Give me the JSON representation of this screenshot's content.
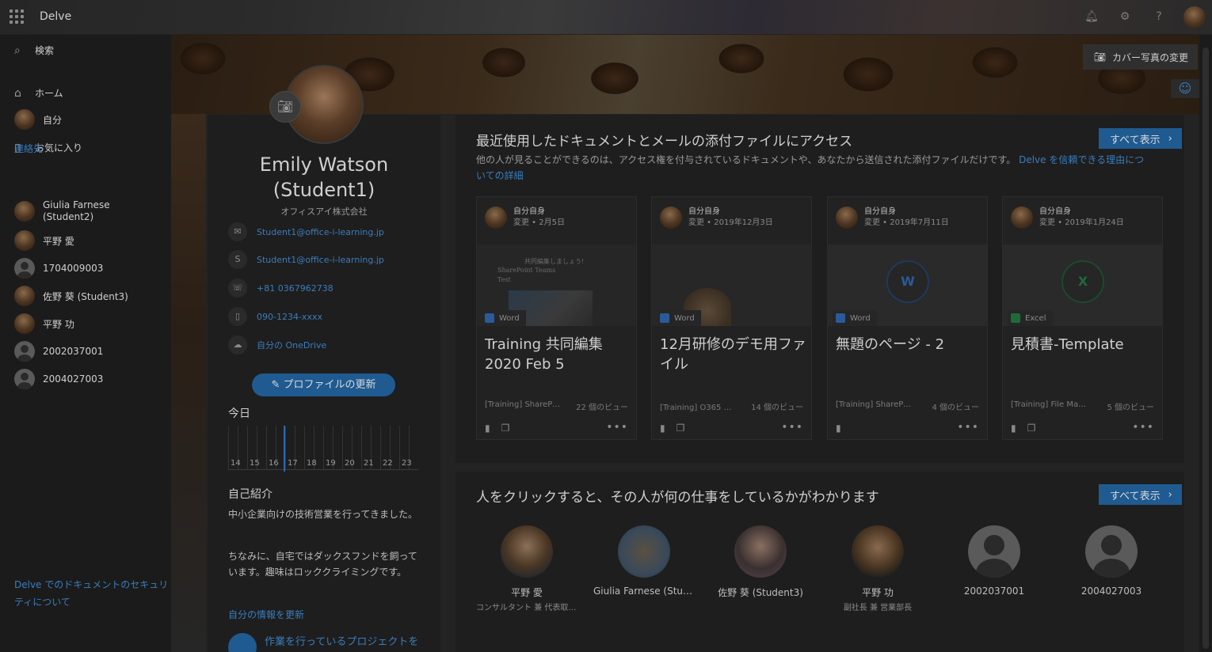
{
  "topbar": {
    "app_title": "Delve"
  },
  "leftnav": {
    "search_label": "検索",
    "items": [
      {
        "label": "ホーム"
      },
      {
        "label": "自分"
      },
      {
        "label": "お気に入り"
      }
    ],
    "contacts_heading": "連絡先",
    "contacts": [
      {
        "name": "Giulia Farnese (Student2)"
      },
      {
        "name": "平野 愛"
      },
      {
        "name": "1704009003"
      },
      {
        "name": "佐野 葵 (Student3)"
      },
      {
        "name": "平野 功"
      },
      {
        "name": "2002037001"
      },
      {
        "name": "2004027003"
      }
    ],
    "security_link": "Delve でのドキュメントのセキュリティについて"
  },
  "cover": {
    "change_label": "カバー写真の変更"
  },
  "profile": {
    "name": "Emily Watson (Student1)",
    "company": "オフィスアイ株式会社",
    "email": "Student1@office-i-learning.jp",
    "im": "Student1@office-i-learning.jp",
    "phone": "+81 0367962738",
    "mobile": "090-1234-xxxx",
    "onedrive": "自分の OneDrive",
    "update_button": "プロファイルの更新",
    "today_label": "今日",
    "hours": [
      "14",
      "15",
      "16",
      "17",
      "18",
      "19",
      "20",
      "21",
      "22",
      "23"
    ],
    "about_heading": "自己紹介",
    "about_p1": "中小企業向けの技術営業を行ってきました。",
    "about_p2": "ちなみに、自宅ではダックスフンドを飼っています。趣味はロッククライミングです。",
    "update_info": "自分の情報を更新",
    "projects_text": "作業を行っているプロジェクトを"
  },
  "docs": {
    "title": "最近使用したドキュメントとメールの添付ファイルにアクセス",
    "desc": "他の人が見ることができるのは、アクセス権を付与されているドキュメントや、あなたから送信された添付ファイルだけです。",
    "desc_link": "Delve を信頼できる理由についての詳細",
    "see_all": "すべて表示",
    "cards": [
      {
        "owner": "自分自身",
        "modified": "変更 • 2月5日",
        "type": "Word",
        "title": "Training 共同編集 2020 Feb 5",
        "location": "[Training] SharePoint",
        "views": "22 個のビュー",
        "thumb_l1": "共同編集しましょう!",
        "thumb_l2": "SharePoint Teams",
        "thumb_l3": "Test"
      },
      {
        "owner": "自分自身",
        "modified": "変更 • 2019年12月3日",
        "type": "Word",
        "title": "12月研修のデモ用ファイル",
        "location": "[Training] O365 研修",
        "views": "14 個のビュー"
      },
      {
        "owner": "自分自身",
        "modified": "変更 • 2019年7月11日",
        "type": "Word",
        "title": "無題のページ - 2",
        "location": "[Training] SharePoint",
        "views": "4 個のビュー",
        "badge": "W"
      },
      {
        "owner": "自分自身",
        "modified": "変更 • 2019年1月24日",
        "type": "Excel",
        "title": "見積書-Template",
        "location": "[Training] File Management",
        "views": "5 個のビュー",
        "badge": "X"
      }
    ]
  },
  "people": {
    "title": "人をクリックすると、その人が何の仕事をしているかがわかります",
    "see_all": "すべて表示",
    "list": [
      {
        "name": "平野 愛",
        "role": "コンサルタント 兼 代表取締役"
      },
      {
        "name": "Giulia Farnese (Student2)",
        "role": ""
      },
      {
        "name": "佐野 葵 (Student3)",
        "role": ""
      },
      {
        "name": "平野 功",
        "role": "副社長 兼 営業部長"
      },
      {
        "name": "2002037001",
        "role": ""
      },
      {
        "name": "2004027003",
        "role": ""
      }
    ]
  },
  "colors": {
    "accent": "#1f5b91",
    "link": "#3a7dbd",
    "word": "#2a5a9a",
    "excel": "#1e6b3a"
  }
}
